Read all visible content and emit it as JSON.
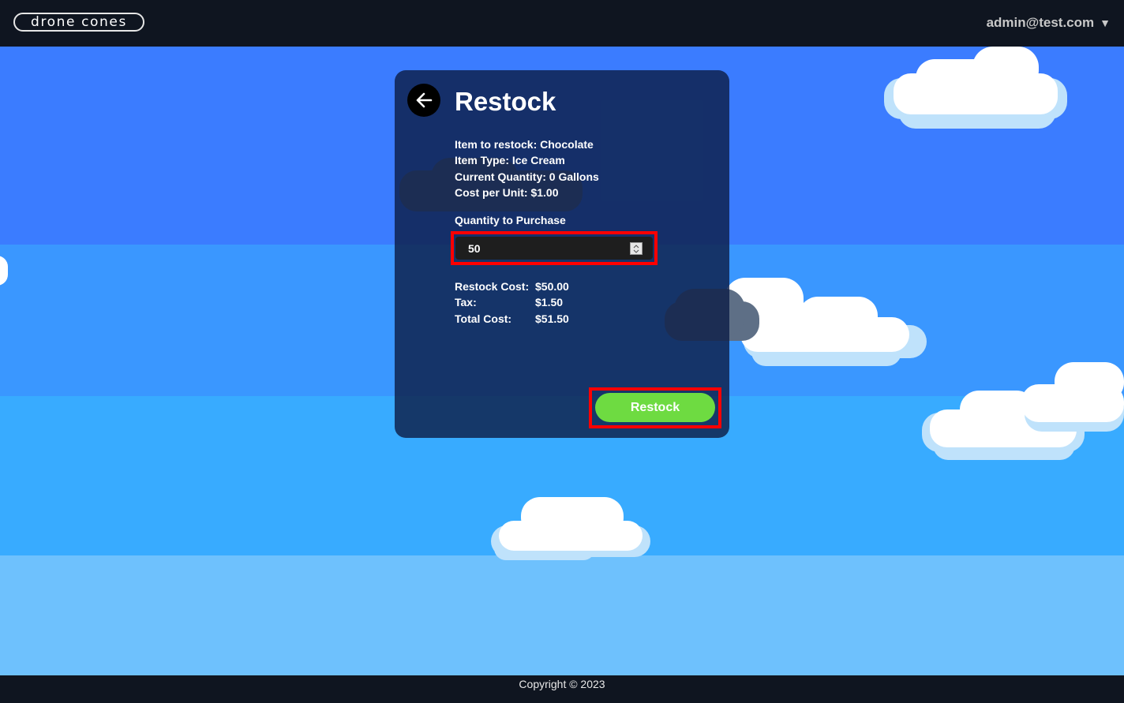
{
  "header": {
    "logo_text": "drone cones",
    "user_email": "admin@test.com",
    "dropdown_icon": "caret-down-icon"
  },
  "restock_form": {
    "back_icon": "arrow-left-icon",
    "title": "Restock",
    "item_line": "Item to restock: Chocolate",
    "type_line": "Item Type: Ice Cream",
    "quantity_line": "Current Quantity: 0 Gallons",
    "unit_cost_line": "Cost per Unit: $1.00",
    "quantity_label": "Quantity to Purchase",
    "quantity_value": "50",
    "costs": [
      {
        "label": "Restock Cost:",
        "value": "$50.00"
      },
      {
        "label": "Tax:",
        "value": "$1.50"
      },
      {
        "label": "Total Cost:",
        "value": "$51.50"
      }
    ],
    "submit_label": "Restock"
  },
  "footer": {
    "copyright": "Copyright © 2023"
  },
  "colors": {
    "accent_green": "#6edb41",
    "highlight_red": "#ff0000",
    "nav_bg": "#0f1520",
    "card_bg": "#0d1f48"
  }
}
